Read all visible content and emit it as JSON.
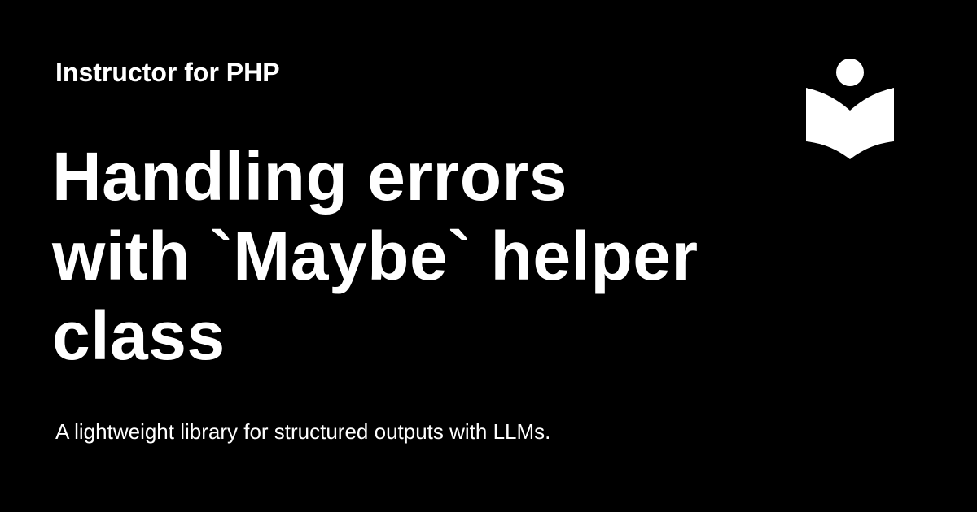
{
  "site": {
    "name": "Instructor for PHP"
  },
  "page": {
    "title_lines": [
      "Handling errors",
      "with `Maybe` helper",
      "class"
    ],
    "description": "A lightweight library for structured outputs with LLMs."
  },
  "logo": {
    "icon": "reader-book-icon",
    "color": "#ffffff"
  },
  "colors": {
    "background": "#000000",
    "text": "#ffffff"
  }
}
